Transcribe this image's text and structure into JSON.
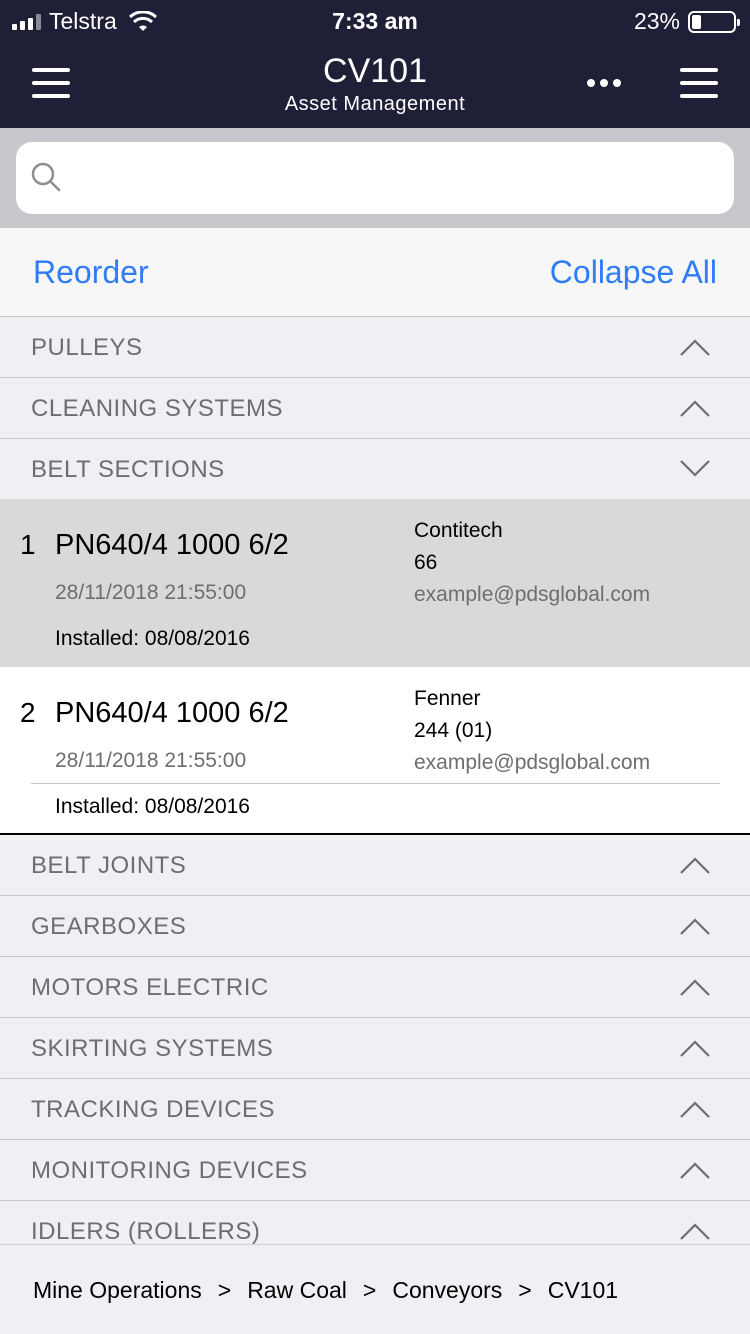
{
  "status": {
    "carrier": "Telstra",
    "time": "7:33 am",
    "battery_pct": "23%",
    "battery_level": 0.23,
    "signal_bars": 3
  },
  "nav": {
    "title": "CV101",
    "subtitle": "Asset Management",
    "left_icon": "hamburger-menu-icon",
    "more_icon": "ellipsis-icon",
    "right_icon": "hamburger-menu-icon"
  },
  "search": {
    "placeholder": "",
    "icon": "search-icon"
  },
  "toolbar": {
    "reorder_label": "Reorder",
    "collapse_label": "Collapse All"
  },
  "sections_top": [
    {
      "label": "PULLEYS",
      "state": "collapsed"
    },
    {
      "label": "CLEANING SYSTEMS",
      "state": "collapsed"
    },
    {
      "label": "BELT SECTIONS",
      "state": "expanded"
    }
  ],
  "belt_items": [
    {
      "num": "1",
      "title": "PN640/4 1000 6/2",
      "date": "28/11/2018 21:55:00",
      "installed": "Installed: 08/08/2016",
      "vendor": "Contitech",
      "code": "66",
      "email": "example@pdsglobal.com"
    },
    {
      "num": "2",
      "title": "PN640/4 1000 6/2",
      "date": "28/11/2018 21:55:00",
      "installed": "Installed: 08/08/2016",
      "vendor": "Fenner",
      "code": "244 (01)",
      "email": "example@pdsglobal.com"
    }
  ],
  "sections_bottom": [
    {
      "label": "BELT JOINTS",
      "state": "collapsed"
    },
    {
      "label": "GEARBOXES",
      "state": "collapsed"
    },
    {
      "label": "MOTORS ELECTRIC",
      "state": "collapsed"
    },
    {
      "label": "SKIRTING SYSTEMS",
      "state": "collapsed"
    },
    {
      "label": "TRACKING DEVICES",
      "state": "collapsed"
    },
    {
      "label": "MONITORING DEVICES",
      "state": "collapsed"
    },
    {
      "label": "IDLERS (ROLLERS)",
      "state": "collapsed"
    }
  ],
  "breadcrumb": {
    "items": [
      "Mine Operations",
      "Raw Coal",
      "Conveyors",
      "CV101"
    ],
    "separator": ">"
  },
  "colors": {
    "header": "#201f38",
    "accent": "#2f7cf6",
    "selected_row": "#d9d9d9"
  }
}
